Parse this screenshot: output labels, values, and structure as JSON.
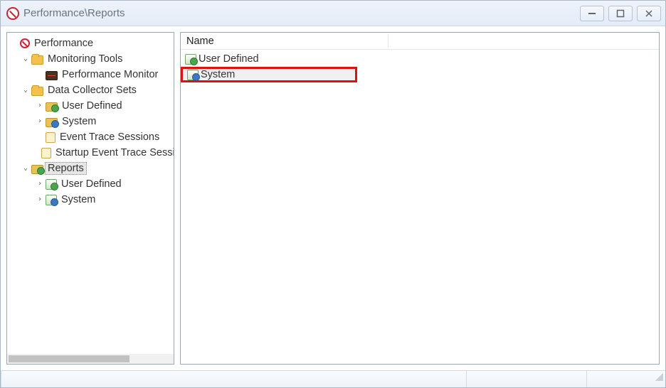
{
  "window": {
    "title": "Performance\\Reports",
    "buttons": {
      "min": "—",
      "max": "▣",
      "close": "✕"
    }
  },
  "tree": {
    "root": "Performance",
    "monitoring": {
      "label": "Monitoring Tools",
      "perfmon": "Performance Monitor"
    },
    "dcs": {
      "label": "Data Collector Sets",
      "user": "User Defined",
      "system": "System",
      "ets": "Event Trace Sessions",
      "startup": "Startup Event Trace Sessions"
    },
    "reports": {
      "label": "Reports",
      "user": "User Defined",
      "system": "System"
    }
  },
  "list": {
    "header": "Name",
    "items": {
      "user": "User Defined",
      "system": "System"
    }
  },
  "highlight": "system"
}
